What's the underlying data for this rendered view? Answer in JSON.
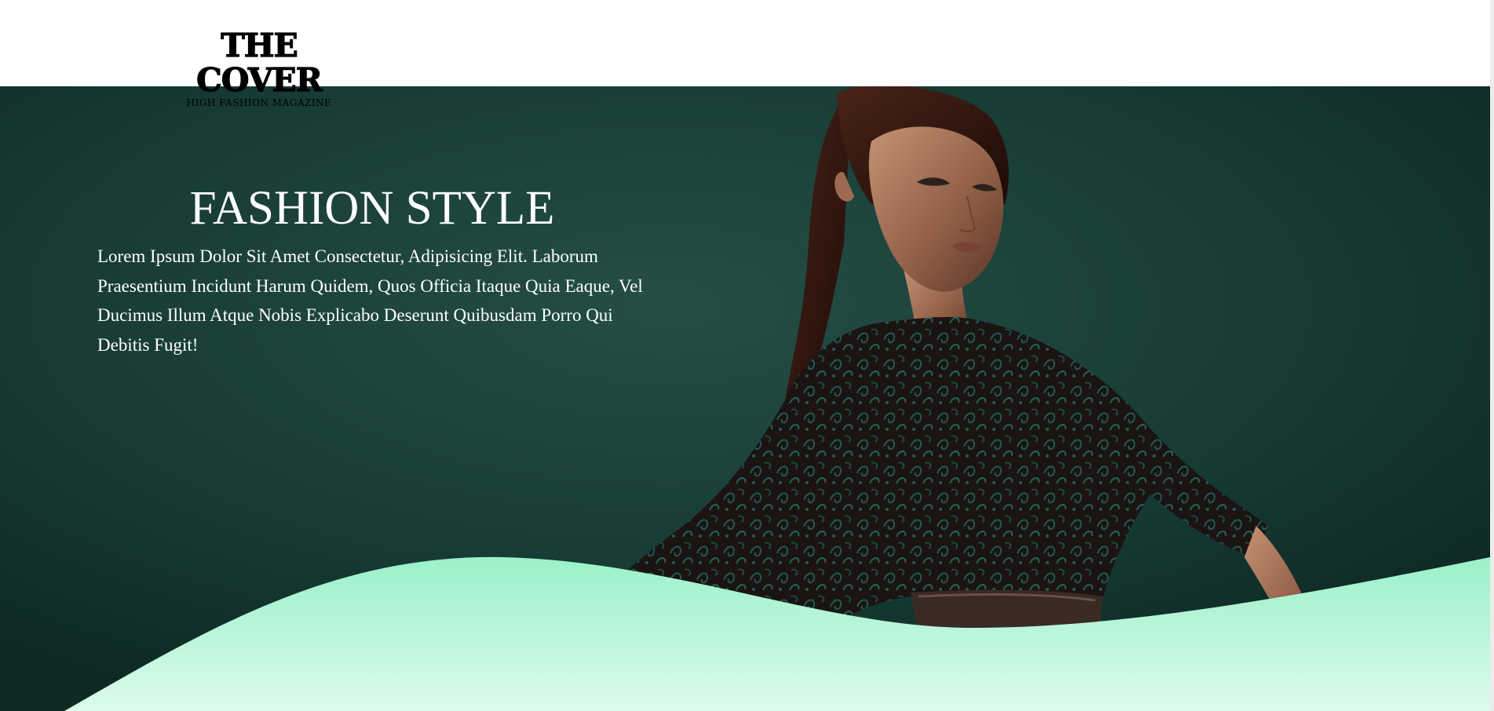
{
  "header": {
    "logo_title": "THE COVER",
    "logo_subtitle": "HIGH FASHION MAGAZINE"
  },
  "hero": {
    "title": "FASHION STYLE",
    "text": "Lorem Ipsum Dolor Sit Amet Consectetur, Adipisicing Elit. Laborum Praesentium Incidunt Harum Quidem, Quos Officia Itaque Quia Eaque, Vel Ducimus Illum Atque Nobis Explicabo Deserunt Quibusdam Porro Qui Debitis Fugit!",
    "background_color": "#173b35",
    "wave_color_top": "#9af1c8",
    "wave_color_bottom": "#dcfbeb"
  }
}
